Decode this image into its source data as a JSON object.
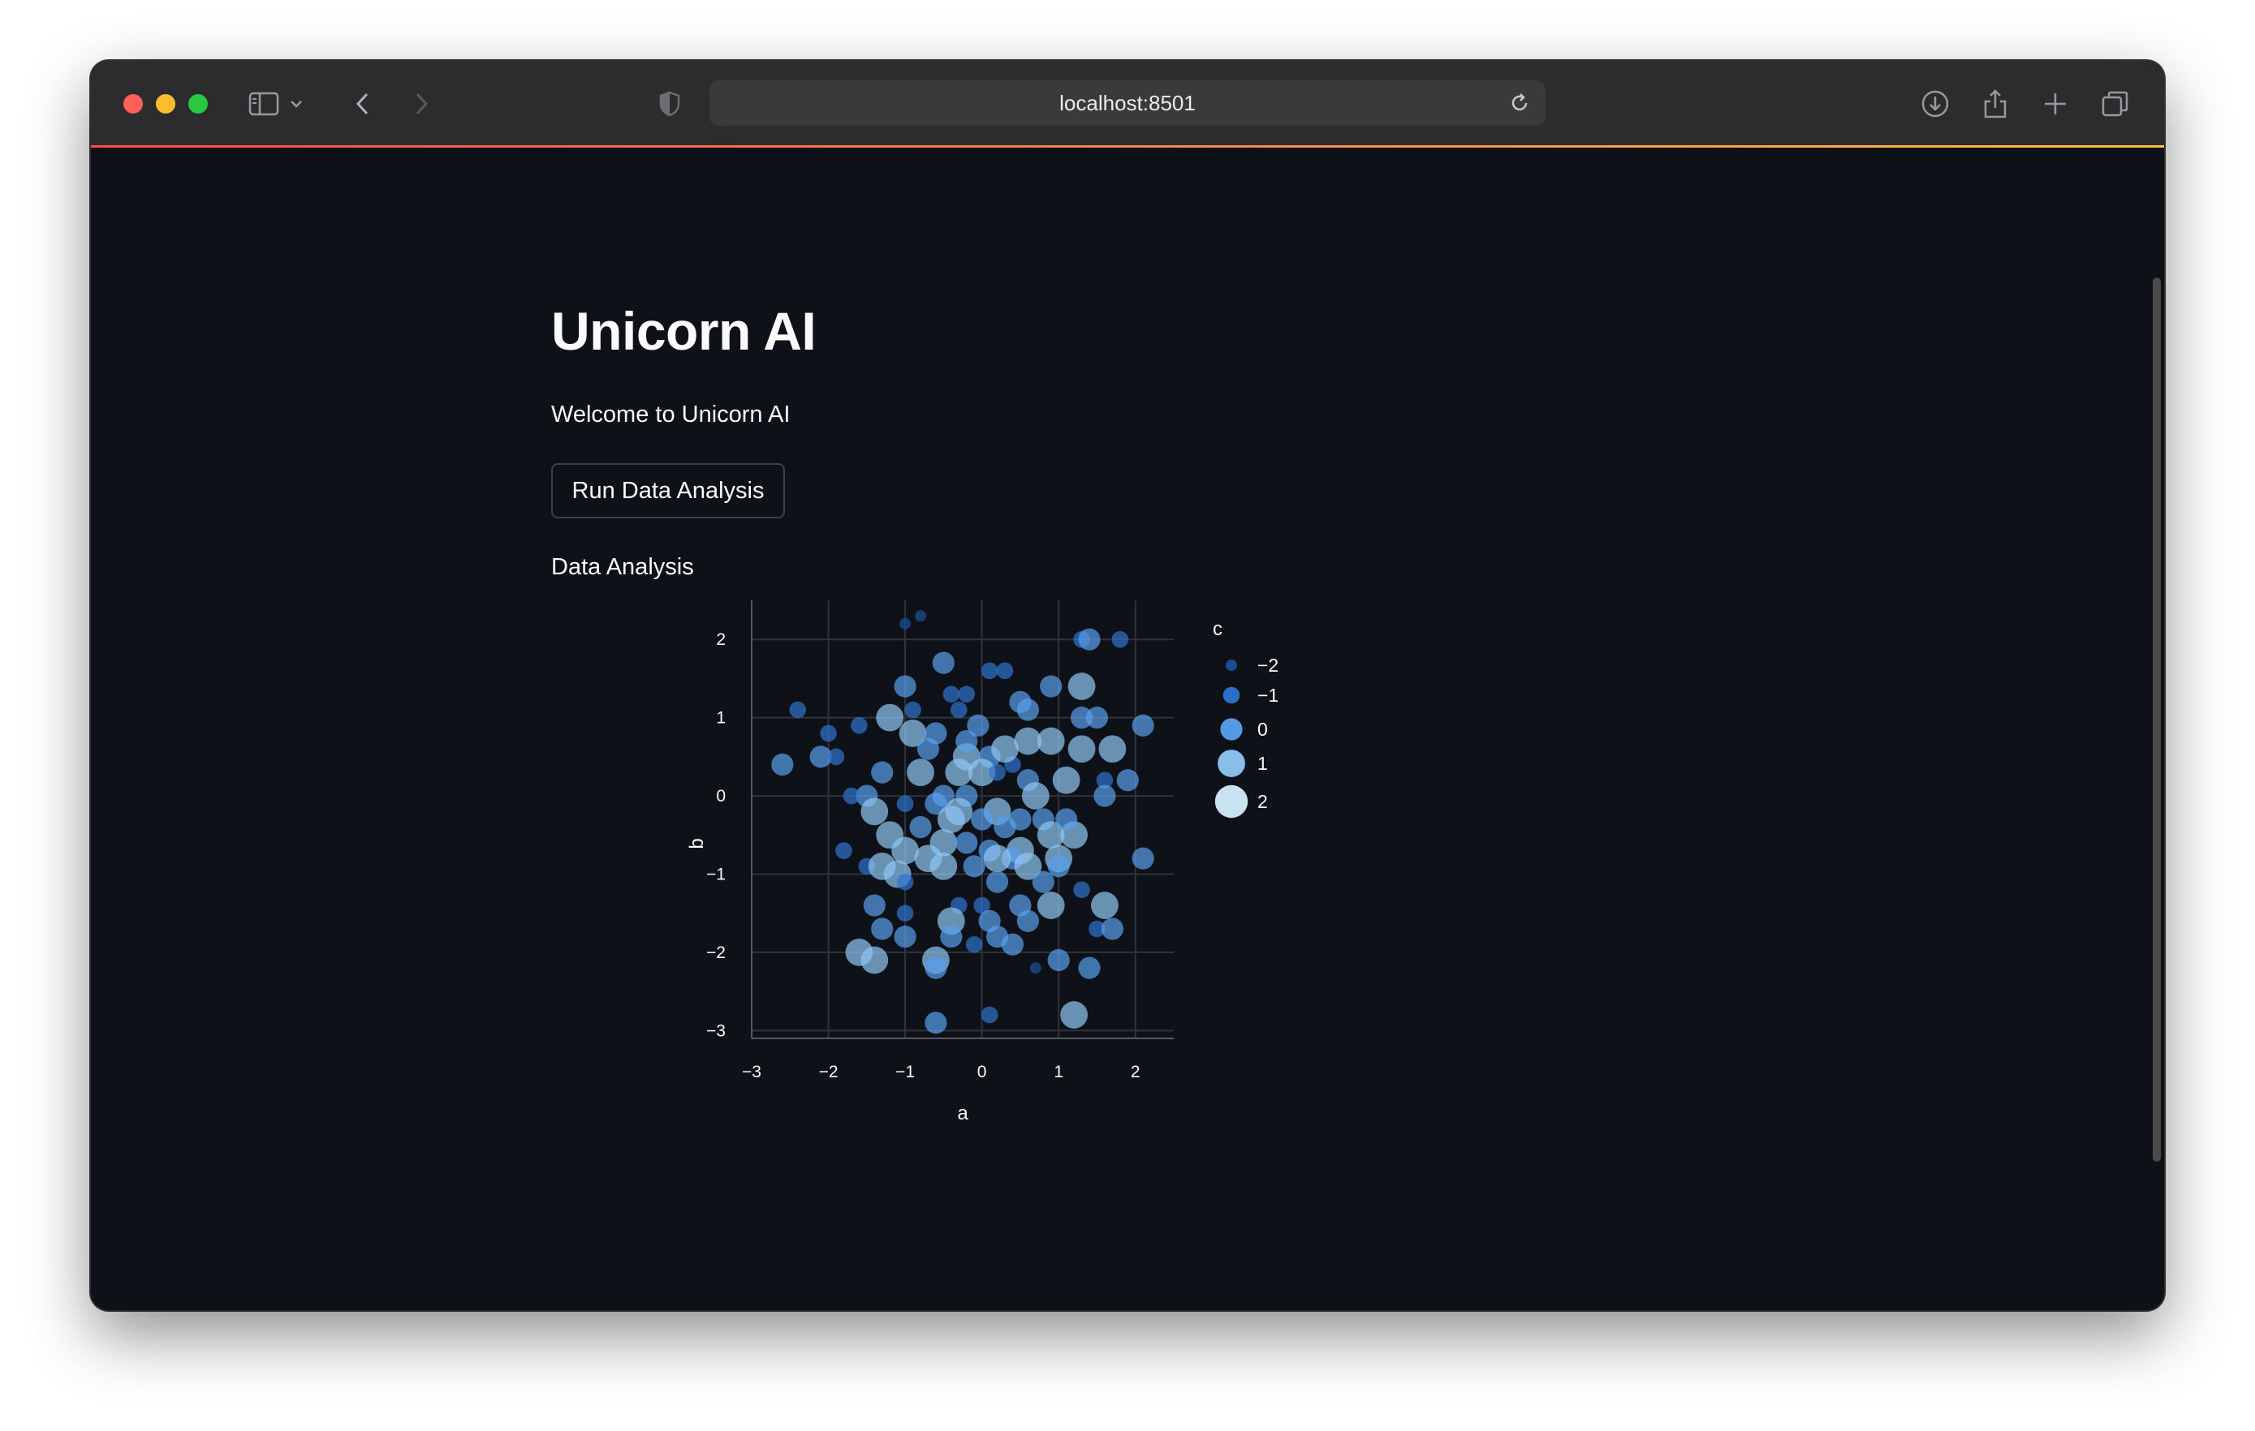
{
  "browser": {
    "url": "localhost:8501",
    "icons": [
      "sidebar-icon",
      "chevron-down-icon",
      "back-icon",
      "forward-icon",
      "shield-icon",
      "reload-icon",
      "download-icon",
      "share-icon",
      "new-tab-icon",
      "tab-overview-icon"
    ]
  },
  "page": {
    "title": "Unicorn AI",
    "welcome": "Welcome to Unicorn AI",
    "run_button": "Run Data Analysis",
    "section_label": "Data Analysis"
  },
  "colors": {
    "background": "#0e1117",
    "accent_left": "#ff4b4b",
    "accent_right": "#ffbd45",
    "text": "#fafafa"
  },
  "chart_data": {
    "type": "scatter",
    "xlabel": "a",
    "ylabel": "b",
    "legend_title": "c",
    "legend_position": "right",
    "grid": true,
    "xlim": [
      -3,
      2.5
    ],
    "ylim": [
      -3.1,
      2.5
    ],
    "x_ticks": [
      "−3",
      "−2",
      "−1",
      "0",
      "1",
      "2"
    ],
    "y_ticks": [
      "2",
      "1",
      "0",
      "−1",
      "−2",
      "−3"
    ],
    "legend": [
      {
        "label": "−2",
        "value": -2
      },
      {
        "label": "−1",
        "value": -1
      },
      {
        "label": "0",
        "value": 0
      },
      {
        "label": "1",
        "value": 1
      },
      {
        "label": "2",
        "value": 2
      }
    ],
    "points": [
      [
        -1.0,
        2.2,
        -2
      ],
      [
        -0.8,
        2.3,
        -2
      ],
      [
        1.3,
        2.0,
        -1
      ],
      [
        1.8,
        2.0,
        -1
      ],
      [
        1.4,
        2.0,
        0
      ],
      [
        -0.5,
        1.7,
        0
      ],
      [
        0.1,
        1.6,
        -1
      ],
      [
        0.3,
        1.6,
        -1
      ],
      [
        1.3,
        1.4,
        1
      ],
      [
        0.9,
        1.4,
        0
      ],
      [
        -1.0,
        1.4,
        0
      ],
      [
        -0.4,
        1.3,
        -1
      ],
      [
        -0.2,
        1.3,
        -1
      ],
      [
        0.5,
        1.2,
        0
      ],
      [
        -0.9,
        1.1,
        -1
      ],
      [
        -0.3,
        1.1,
        -1
      ],
      [
        0.6,
        1.1,
        0
      ],
      [
        -2.4,
        1.1,
        -1
      ],
      [
        -1.2,
        1.0,
        1
      ],
      [
        -1.6,
        0.9,
        -1
      ],
      [
        -2.0,
        0.8,
        -1
      ],
      [
        -0.05,
        0.9,
        0
      ],
      [
        1.3,
        1.0,
        0
      ],
      [
        1.5,
        1.0,
        0
      ],
      [
        2.1,
        0.9,
        0
      ],
      [
        -0.9,
        0.8,
        1
      ],
      [
        -0.6,
        0.8,
        0
      ],
      [
        0.6,
        0.7,
        1
      ],
      [
        0.9,
        0.7,
        1
      ],
      [
        1.3,
        0.6,
        1
      ],
      [
        1.7,
        0.6,
        1
      ],
      [
        -2.1,
        0.5,
        0
      ],
      [
        -1.9,
        0.5,
        -1
      ],
      [
        -0.2,
        0.5,
        1
      ],
      [
        0.1,
        0.5,
        0
      ],
      [
        0.4,
        0.4,
        -1
      ],
      [
        -2.6,
        0.4,
        0
      ],
      [
        -1.3,
        0.3,
        0
      ],
      [
        -0.8,
        0.3,
        1
      ],
      [
        -0.3,
        0.3,
        1
      ],
      [
        0.0,
        0.3,
        1
      ],
      [
        0.2,
        0.3,
        -1
      ],
      [
        0.6,
        0.2,
        0
      ],
      [
        1.1,
        0.2,
        1
      ],
      [
        1.6,
        0.2,
        -1
      ],
      [
        1.9,
        0.2,
        0
      ],
      [
        -1.5,
        0.0,
        0
      ],
      [
        -0.5,
        0.0,
        0
      ],
      [
        -0.2,
        0.0,
        0
      ],
      [
        0.7,
        0.0,
        1
      ],
      [
        1.6,
        0.0,
        0
      ],
      [
        -1.0,
        -0.1,
        -1
      ],
      [
        -0.6,
        -0.1,
        0
      ],
      [
        -0.3,
        -0.2,
        1
      ],
      [
        0.2,
        -0.2,
        1
      ],
      [
        0.5,
        -0.3,
        0
      ],
      [
        0.8,
        -0.3,
        0
      ],
      [
        -1.4,
        -0.2,
        1
      ],
      [
        -0.8,
        -0.4,
        0
      ],
      [
        -0.4,
        -0.3,
        1
      ],
      [
        0.3,
        -0.4,
        0
      ],
      [
        0.9,
        -0.5,
        1
      ],
      [
        -1.2,
        -0.5,
        1
      ],
      [
        -0.5,
        -0.6,
        1
      ],
      [
        -0.2,
        -0.6,
        0
      ],
      [
        0.1,
        -0.7,
        0
      ],
      [
        0.5,
        -0.7,
        1
      ],
      [
        1.2,
        -0.5,
        1
      ],
      [
        -1.8,
        -0.7,
        -1
      ],
      [
        -1.0,
        -0.7,
        1
      ],
      [
        -0.7,
        -0.8,
        1
      ],
      [
        0.4,
        -0.8,
        0
      ],
      [
        1.0,
        -0.8,
        1
      ],
      [
        -1.5,
        -0.9,
        -1
      ],
      [
        -1.3,
        -0.9,
        1
      ],
      [
        -1.1,
        -1.0,
        1
      ],
      [
        -0.5,
        -0.9,
        1
      ],
      [
        -0.1,
        -0.9,
        0
      ],
      [
        0.2,
        -0.8,
        1
      ],
      [
        0.6,
        -0.9,
        1
      ],
      [
        1.0,
        -0.9,
        0
      ],
      [
        2.1,
        -0.8,
        0
      ],
      [
        -1.0,
        -1.1,
        -1
      ],
      [
        0.2,
        -1.1,
        0
      ],
      [
        0.8,
        -1.1,
        0
      ],
      [
        1.3,
        -1.2,
        -1
      ],
      [
        -1.4,
        -1.4,
        0
      ],
      [
        -1.0,
        -1.5,
        -1
      ],
      [
        -0.3,
        -1.4,
        -1
      ],
      [
        0.0,
        -1.4,
        -1
      ],
      [
        0.5,
        -1.4,
        0
      ],
      [
        0.9,
        -1.4,
        1
      ],
      [
        1.6,
        -1.4,
        1
      ],
      [
        -0.4,
        -1.6,
        1
      ],
      [
        0.1,
        -1.6,
        0
      ],
      [
        0.6,
        -1.6,
        0
      ],
      [
        1.5,
        -1.7,
        -1
      ],
      [
        1.7,
        -1.7,
        0
      ],
      [
        -1.3,
        -1.7,
        0
      ],
      [
        -1.0,
        -1.8,
        0
      ],
      [
        -0.4,
        -1.8,
        0
      ],
      [
        0.2,
        -1.8,
        0
      ],
      [
        -0.1,
        -1.9,
        -1
      ],
      [
        0.4,
        -1.9,
        0
      ],
      [
        -1.6,
        -2.0,
        1
      ],
      [
        -1.4,
        -2.1,
        1
      ],
      [
        -0.6,
        -2.1,
        1
      ],
      [
        -0.6,
        -2.2,
        0
      ],
      [
        1.0,
        -2.1,
        0
      ],
      [
        1.4,
        -2.2,
        0
      ],
      [
        0.7,
        -2.2,
        -2
      ],
      [
        -0.6,
        -2.9,
        0
      ],
      [
        0.1,
        -2.8,
        -1
      ],
      [
        1.2,
        -2.8,
        1
      ],
      [
        -0.2,
        0.7,
        0
      ],
      [
        0.3,
        0.6,
        1
      ],
      [
        -0.7,
        0.6,
        0
      ],
      [
        0.0,
        -0.3,
        0
      ],
      [
        1.1,
        -0.3,
        0
      ],
      [
        -1.7,
        0.0,
        -1
      ]
    ]
  }
}
